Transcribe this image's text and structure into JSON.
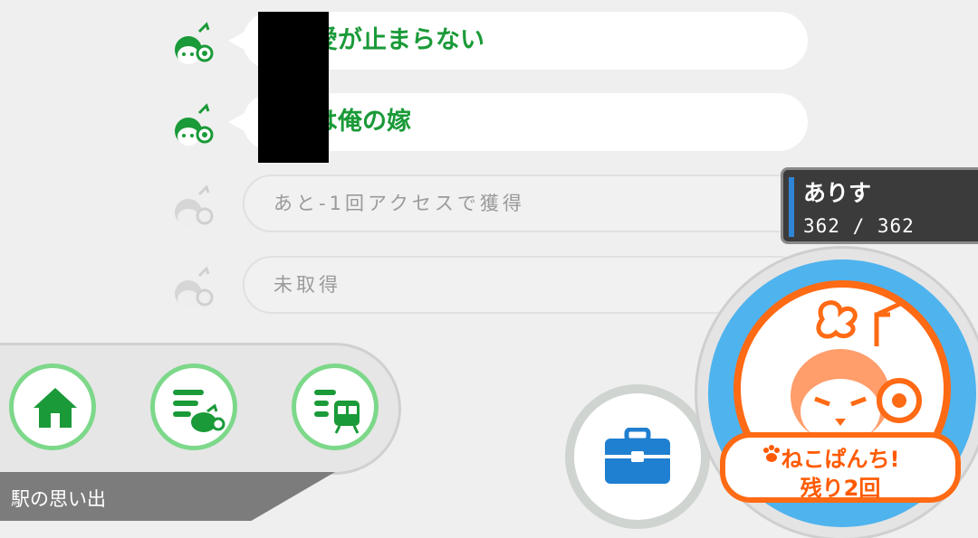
{
  "memories": [
    {
      "text": "愛が止まらない",
      "locked": false
    },
    {
      "text": "は俺の嫁",
      "locked": false
    },
    {
      "text": "あと-1回アクセスで獲得",
      "locked": true
    },
    {
      "text": "未取得",
      "locked": true
    }
  ],
  "player": {
    "name": "ありす",
    "hp": "362 / 362"
  },
  "menu": {
    "label": "駅の思い出",
    "buttons": [
      "home-icon",
      "memory-list-icon",
      "station-list-icon"
    ]
  },
  "neko_punch": {
    "line1": "ねこぱんち!",
    "line2": "残り2回"
  },
  "colors": {
    "green": "#1a9a38",
    "orange": "#ff6a14",
    "blue": "#4fb3ee",
    "briefcase": "#1f7fd0"
  }
}
